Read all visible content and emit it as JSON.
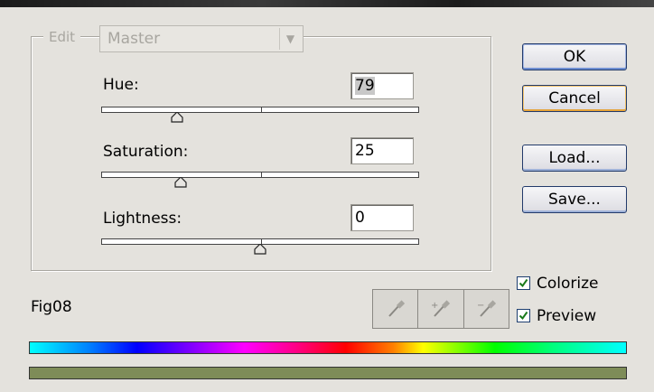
{
  "edit": {
    "legend": "Edit",
    "selected": "Master"
  },
  "sliders": [
    {
      "label": "Hue:",
      "value": "79",
      "position": 0.24
    },
    {
      "label": "Saturation:",
      "value": "25",
      "position": 0.25
    },
    {
      "label": "Lightness:",
      "value": "0",
      "position": 0.5
    }
  ],
  "buttons": {
    "ok": "OK",
    "cancel": "Cancel",
    "load": "Load...",
    "save": "Save..."
  },
  "options": {
    "colorize": {
      "label": "Colorize",
      "checked": true
    },
    "preview": {
      "label": "Preview",
      "checked": true
    }
  },
  "figure_label": "Fig08",
  "eyedroppers": [
    "eyedropper-icon",
    "eyedropper-plus-icon",
    "eyedropper-minus-icon"
  ],
  "colors": {
    "result_bar": "#7e8c58",
    "button_border": "#223a6a",
    "check_mark": "#1a7a1a"
  }
}
